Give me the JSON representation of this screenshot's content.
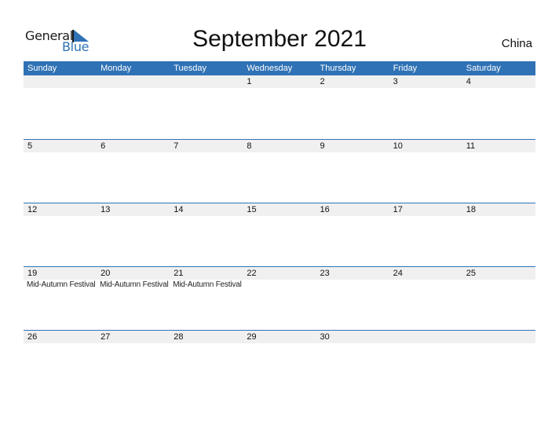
{
  "logo": {
    "line1": "General",
    "line2": "Blue"
  },
  "title": "September 2021",
  "country": "China",
  "colors": {
    "accent": "#2f72b5",
    "band": "#f0f0f0"
  },
  "weekdays": [
    "Sunday",
    "Monday",
    "Tuesday",
    "Wednesday",
    "Thursday",
    "Friday",
    "Saturday"
  ],
  "weeks": [
    {
      "days": [
        "",
        "",
        "",
        "1",
        "2",
        "3",
        "4"
      ],
      "events": [
        "",
        "",
        "",
        "",
        "",
        "",
        ""
      ]
    },
    {
      "days": [
        "5",
        "6",
        "7",
        "8",
        "9",
        "10",
        "11"
      ],
      "events": [
        "",
        "",
        "",
        "",
        "",
        "",
        ""
      ]
    },
    {
      "days": [
        "12",
        "13",
        "14",
        "15",
        "16",
        "17",
        "18"
      ],
      "events": [
        "",
        "",
        "",
        "",
        "",
        "",
        ""
      ]
    },
    {
      "days": [
        "19",
        "20",
        "21",
        "22",
        "23",
        "24",
        "25"
      ],
      "events": [
        "Mid-Autumn Festival",
        "Mid-Autumn Festival",
        "Mid-Autumn Festival",
        "",
        "",
        "",
        ""
      ]
    },
    {
      "days": [
        "26",
        "27",
        "28",
        "29",
        "30",
        "",
        ""
      ],
      "events": [
        "",
        "",
        "",
        "",
        "",
        "",
        ""
      ]
    }
  ]
}
